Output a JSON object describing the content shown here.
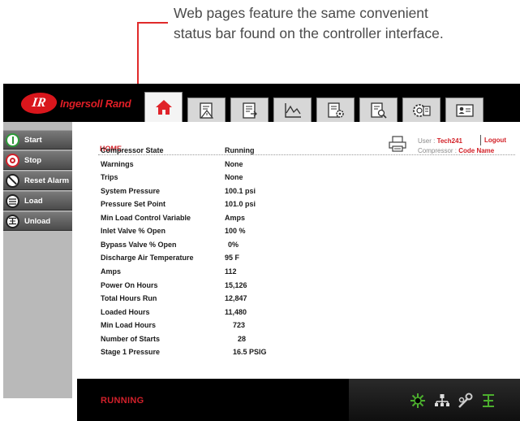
{
  "callout": {
    "line1": "Web pages feature the same convenient",
    "line2": "status bar found on the controller interface.",
    "color": "#e02a2a"
  },
  "header": {
    "brand_mark": "IR",
    "brand_name": "Ingersoll Rand",
    "tabs": [
      {
        "icon": "home-icon",
        "active": true
      },
      {
        "icon": "alarm-report-icon",
        "active": false
      },
      {
        "icon": "event-list-icon",
        "active": false
      },
      {
        "icon": "trend-chart-icon",
        "active": false
      },
      {
        "icon": "settings-sheet-icon",
        "active": false
      },
      {
        "icon": "document-search-icon",
        "active": false
      },
      {
        "icon": "service-gear-icon",
        "active": false
      },
      {
        "icon": "user-card-icon",
        "active": false
      }
    ]
  },
  "sidebar": {
    "buttons": [
      {
        "label": "Start",
        "icon": "start-icon",
        "color": "#2e9a3a"
      },
      {
        "label": "Stop",
        "icon": "stop-icon",
        "color": "#d0202a"
      },
      {
        "label": "Reset Alarm",
        "icon": "reset-alarm-icon",
        "color": "#222222"
      },
      {
        "label": "Load",
        "icon": "load-icon",
        "color": "#222222"
      },
      {
        "label": "Unload",
        "icon": "unload-icon",
        "color": "#222222"
      }
    ]
  },
  "main": {
    "title": "HOME",
    "user_label": "User : ",
    "user_name": "Tech241",
    "compressor_label": "Compressor : ",
    "compressor_name": "Code Name",
    "logout": "Logout",
    "rows": [
      {
        "label": "Compressor State",
        "value": "Running"
      },
      {
        "label": "Warnings",
        "value": "None"
      },
      {
        "label": "Trips",
        "value": "None"
      },
      {
        "label": "System Pressure",
        "value": "100.1 psi"
      },
      {
        "label": "Pressure Set Point",
        "value": "101.0 psi"
      },
      {
        "label": "Min Load Control Variable",
        "value": "Amps"
      },
      {
        "label": "Inlet Valve % Open",
        "value": "100 %"
      },
      {
        "label": "Bypass Valve % Open",
        "value": "0%"
      },
      {
        "label": "Discharge Air Temperature",
        "value": "95 F"
      },
      {
        "label": "Amps",
        "value": "112"
      },
      {
        "label": "Power On Hours",
        "value": "15,126"
      },
      {
        "label": "Total Hours Run",
        "value": "12,847"
      },
      {
        "label": "Loaded Hours",
        "value": "11,480"
      },
      {
        "label": "Min Load Hours",
        "value": "723"
      },
      {
        "label": "Number of Starts",
        "value": "28"
      },
      {
        "label": "Stage 1 Pressure",
        "value": "16.5 PSIG"
      }
    ]
  },
  "statusbar": {
    "state": "RUNNING",
    "state_color": "#d0202a",
    "icon_color": "#4caf2e",
    "icons": [
      "fan-running-icon",
      "network-icon",
      "maintenance-icon",
      "load-status-icon"
    ]
  }
}
